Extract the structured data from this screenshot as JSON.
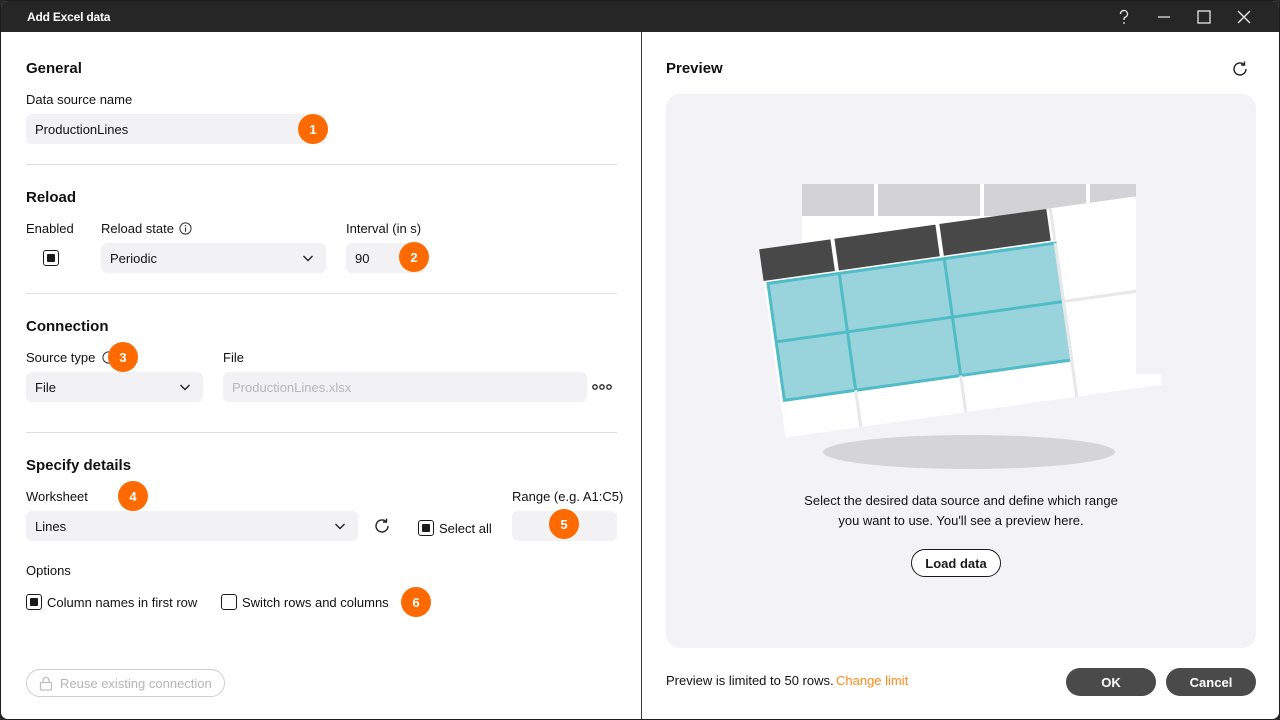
{
  "window": {
    "title": "Add Excel data"
  },
  "general": {
    "heading": "General",
    "data_source_label": "Data source name",
    "data_source_value": "ProductionLines",
    "badge": "1"
  },
  "reload": {
    "heading": "Reload",
    "enabled_label": "Enabled",
    "enabled_checked": true,
    "state_label": "Reload state",
    "state_value": "Periodic",
    "interval_label": "Interval (in s)",
    "interval_value": "90",
    "badge": "2"
  },
  "connection": {
    "heading": "Connection",
    "source_type_label": "Source type",
    "source_type_value": "File",
    "file_label": "File",
    "file_placeholder": "ProductionLines.xlsx",
    "badge": "3"
  },
  "details": {
    "heading": "Specify details",
    "worksheet_label": "Worksheet",
    "worksheet_value": "Lines",
    "select_all_label": "Select all",
    "range_label": "Range (e.g. A1:C5)",
    "worksheet_badge": "4",
    "range_badge": "5"
  },
  "options": {
    "label": "Options",
    "column_names_label": "Column names in first row",
    "switch_label": "Switch rows and columns",
    "badge": "6"
  },
  "reuse_label": "Reuse existing connection",
  "preview": {
    "heading": "Preview",
    "message_line1": "Select the desired data source and define which range",
    "message_line2": "you want to use. You'll see a preview here.",
    "load_button": "Load data",
    "limit_text": "Preview is limited to 50 rows.",
    "change_limit": "Change limit"
  },
  "buttons": {
    "ok": "OK",
    "cancel": "Cancel"
  },
  "colors": {
    "accent": "#ff6a00",
    "titlebar": "#262626",
    "teal": "#4fbcc8",
    "teal_fill": "#99d4dc"
  }
}
